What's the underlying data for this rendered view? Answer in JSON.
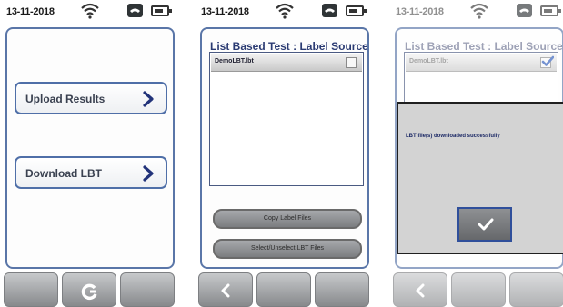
{
  "screen1": {
    "date": "13-11-2018",
    "upload_button": "Upload Results",
    "download_button": "Download LBT"
  },
  "screen2": {
    "date": "13-11-2018",
    "list_title": "List Based Test : Label Source F",
    "list_items": [
      {
        "label": "DemoLBT.lbt",
        "checked": false
      }
    ],
    "copy_button": "Copy Label Files",
    "select_button": "Select/Unselect LBT Files"
  },
  "screen3": {
    "date": "13-11-2018",
    "list_title": "List Based Test : Label Source I",
    "list_items": [
      {
        "label": "DemoLBT.lbt",
        "checked": true
      }
    ],
    "dialog_message": "LBT file(s) downloaded successfully"
  },
  "icons": {
    "status": [
      "wifi-icon",
      "phone-icon",
      "battery-icon"
    ],
    "nav_screen1": [
      "blank",
      "refresh-icon",
      "blank"
    ],
    "nav_screen2": [
      "back-arrow-icon",
      "blank",
      "blank"
    ],
    "nav_screen3": [
      "back-arrow-icon",
      "blank",
      "blank"
    ],
    "dialog_ok": "checkmark-icon"
  },
  "colors": {
    "accent_border": "#4f6fa8",
    "title_text": "#2a3a72",
    "nav_gray": "#a8aaad",
    "check_blue": "#2d5ab8"
  }
}
